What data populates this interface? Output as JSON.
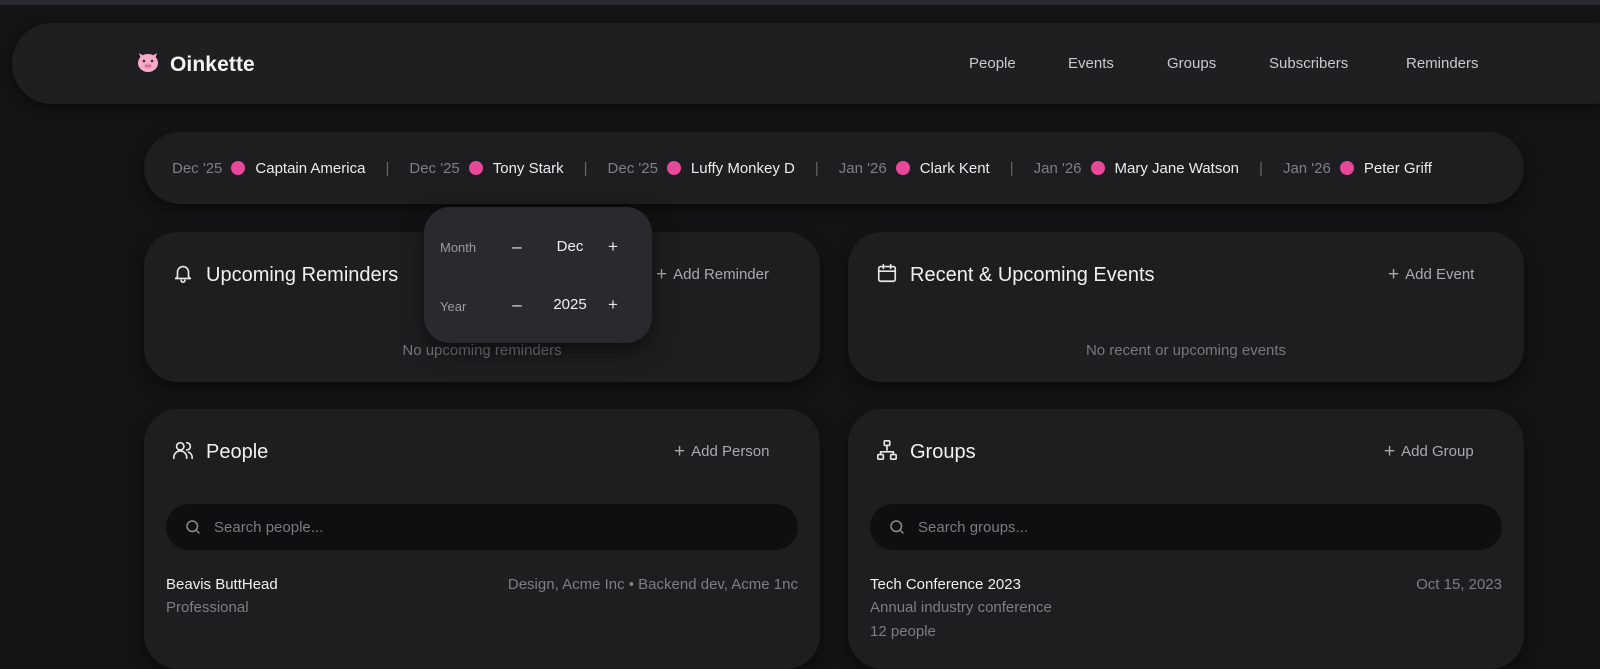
{
  "app": {
    "name": "Oinkette",
    "logo_icon": "pig-face-icon"
  },
  "nav": {
    "people": "People",
    "events": "Events",
    "groups": "Groups",
    "subscribers": "Subscribers",
    "reminders": "Reminders"
  },
  "ticker": [
    {
      "date": "Dec '25",
      "name": "Captain America"
    },
    {
      "date": "Dec '25",
      "name": "Tony Stark"
    },
    {
      "date": "Dec '25",
      "name": "Luffy Monkey D"
    },
    {
      "date": "Jan '26",
      "name": "Clark Kent"
    },
    {
      "date": "Jan '26",
      "name": "Mary Jane Watson"
    },
    {
      "date": "Jan '26",
      "name": "Peter Griff"
    }
  ],
  "ticker_separator": "|",
  "reminders_card": {
    "title": "Upcoming Reminders",
    "action": "Add Reminder",
    "empty": "No upcoming reminders"
  },
  "events_card": {
    "title": "Recent & Upcoming Events",
    "action": "Add Event",
    "empty": "No recent or upcoming events"
  },
  "people_card": {
    "title": "People",
    "action": "Add Person",
    "search_placeholder": "Search people...",
    "row": {
      "name": "Beavis ButtHead",
      "sub": "Professional",
      "meta": "Design, Acme Inc • Backend dev, Acme 1nc"
    }
  },
  "groups_card": {
    "title": "Groups",
    "action": "Add Group",
    "search_placeholder": "Search groups...",
    "row": {
      "name": "Tech Conference 2023",
      "sub": "Annual industry conference",
      "date": "Oct 15, 2023",
      "extra": "12 people"
    }
  },
  "date_picker": {
    "month_label": "Month",
    "month_value": "Dec",
    "year_label": "Year",
    "year_value": "2025",
    "minus": "–",
    "plus": "+"
  },
  "colors": {
    "accent_pink": "#e8489a",
    "background": "#141416",
    "card": "#1e1e21"
  }
}
